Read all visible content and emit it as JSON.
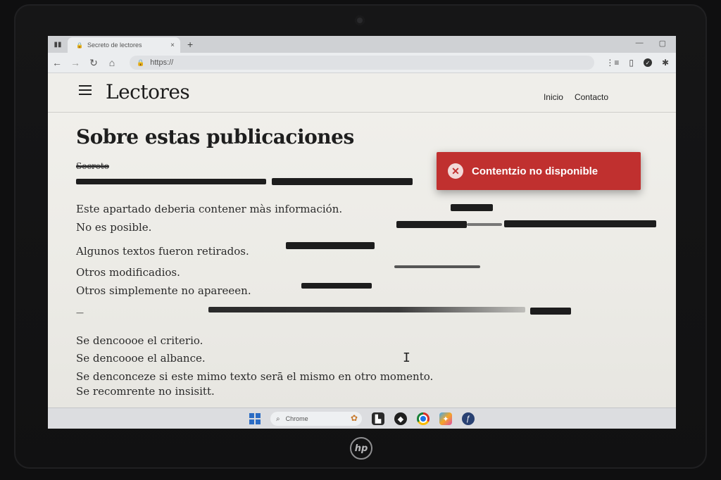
{
  "browser": {
    "tab_title": "Secreto de lectores",
    "tab_close": "×",
    "new_tab": "+",
    "address": "https://"
  },
  "site": {
    "brand": "Lectores",
    "nav": [
      "Inicio",
      "Contacto"
    ]
  },
  "article": {
    "title": "Sobre estas publicaciones",
    "redacted_label": "Secreto",
    "lines": [
      "Este apartado deberia contener màs información.",
      "No es posible.",
      "Algunos textos fueron retirados.",
      "Otros modificadios.",
      "Otros simplemente no apareeen.",
      "—",
      "Se dencoooe el criterio.",
      "Se dencoooe el albance.",
      "Se denconceze si este mimo texto serā el mismo en otro momento.",
      "Se recomrente no insisitt."
    ]
  },
  "toast": {
    "icon": "error-x-icon",
    "message": "Contentzio no disponible",
    "color": "#c0302f"
  },
  "taskbar": {
    "search_label": "Chrome"
  },
  "hardware": {
    "logo": "hp"
  }
}
